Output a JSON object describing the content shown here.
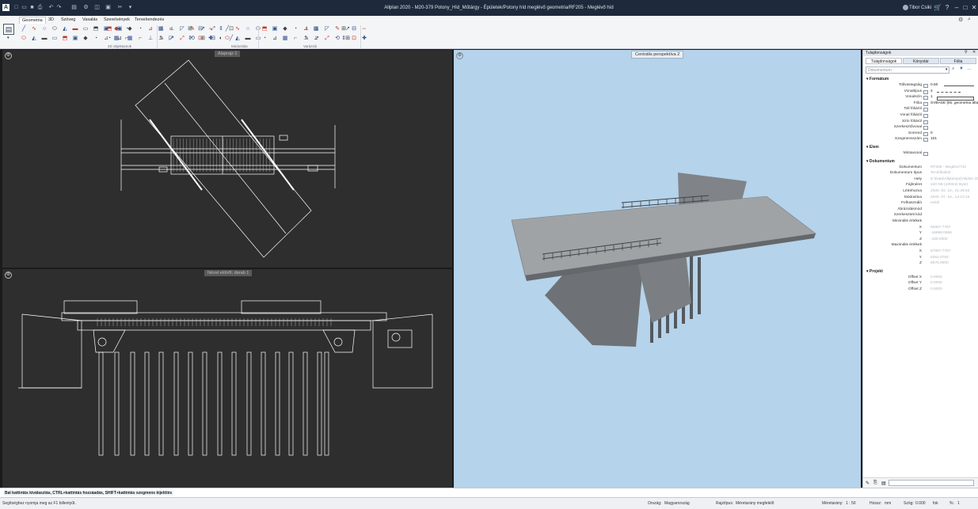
{
  "titlebar": {
    "title": "Allplan 2020 - M20-379 Potony_Híd_Műtárgy - Épületek/Potony híd meglévő geometria/RF205 - Meglévő híd",
    "user": "Tibor Csiki",
    "app_icon": "allplan-logo-icon"
  },
  "ribbon": {
    "tabs": [
      "Geometria",
      "3D",
      "Szöveg",
      "Vasalás",
      "Szerelvények",
      "Tervelrendezés"
    ],
    "active_tab": "Geometria",
    "groups": [
      "2D objektumok",
      "Módosítás",
      "Varázsló"
    ]
  },
  "viewports": {
    "top_left_label": "Alaprajz 1",
    "bottom_left_label": "Nézet elölről, darab 1",
    "right_label": "Centrális perspektíva 2"
  },
  "properties": {
    "panel_title": "Tulajdonságok",
    "tabs": [
      "Tulajdonságok",
      "Könyvtár",
      "Fólia"
    ],
    "active_tab": "Tulajdonságok",
    "search_value": "Dokumentum",
    "sections": {
      "formatum": "Formátum",
      "elem": "Elem",
      "dokumentum": "Dokumentum",
      "projekt": "Projekt"
    },
    "formatum_rows": [
      {
        "label": "Tollvastagság",
        "value": "0.50"
      },
      {
        "label": "Vonaltípus",
        "value": "4"
      },
      {
        "label": "Vonalszín",
        "value": "1"
      },
      {
        "label": "Fólia",
        "value": "SVBASE (kb. geometria általán"
      },
      {
        "label": "Toll fóliáról",
        "value": ""
      },
      {
        "label": "Vonal fóliáról",
        "value": ""
      },
      {
        "label": "Szín fóliáról",
        "value": ""
      },
      {
        "label": "Szerkesztővonal",
        "value": ""
      },
      {
        "label": "Sorrend",
        "value": "0"
      },
      {
        "label": "Szegmensszám",
        "value": "101"
      }
    ],
    "elem_rows": [
      {
        "label": "Mintavonal",
        "value": ""
      }
    ],
    "dokumentum_rows": [
      {
        "label": "Dokumentum",
        "value": "RF205 - Meglévő híd"
      },
      {
        "label": "Dokumentum típus",
        "value": "Tervfólia/któ"
      },
      {
        "label": "Hely",
        "value": "E:\\Data\\Allplan\\prj\\Allplan 2020"
      },
      {
        "label": "Fájlméret",
        "value": "440 KB (429342 Byte)"
      },
      {
        "label": "Létrehozva",
        "value": "2020. 03. 10., 21:28:53"
      },
      {
        "label": "Módosítva",
        "value": "2020. 07. 16., 14:10:16"
      },
      {
        "label": "Felhasználó",
        "value": "Heidi"
      },
      {
        "label": "Ábrázolásmód",
        "value": ""
      },
      {
        "label": "Szerkeszteti kód",
        "value": ""
      },
      {
        "label": "Minimális értékek",
        "value": ""
      },
      {
        "label": "X",
        "value": "62657.7787"
      },
      {
        "label": "Y",
        "value": "-16998.0686"
      },
      {
        "label": "Z",
        "value": "-150.0000"
      },
      {
        "label": "Maximális értékek",
        "value": ""
      },
      {
        "label": "X",
        "value": "67867.7787"
      },
      {
        "label": "Y",
        "value": "6352.0793"
      },
      {
        "label": "Z",
        "value": "8075.0000"
      }
    ],
    "projekt_rows": [
      {
        "label": "Offset X",
        "value": "0.0000"
      },
      {
        "label": "Offset Y",
        "value": "0.0000"
      },
      {
        "label": "Offset Z",
        "value": "0.0000"
      }
    ]
  },
  "prompt": {
    "text": "Bal kattintás kiválasztás, CTRL+kattintás hozzáadás, SHIFT+kattintás szegmens kijelölés"
  },
  "status": {
    "help": "Segítséghez nyomja meg az F1 billentyűt.",
    "country_label": "Ország:",
    "country": "Magyarország",
    "drawing_type_label": "Rajztípus:",
    "drawing_type": "Méretarány megfelelő",
    "scale_label": "Méretarány:",
    "scale": "1 : 50",
    "length_label": "Hossz:",
    "length": "mm",
    "angle_label": "Szög:",
    "angle": "0.000",
    "angle_unit": "fok",
    "percent_label": "%:",
    "percent": "1"
  }
}
